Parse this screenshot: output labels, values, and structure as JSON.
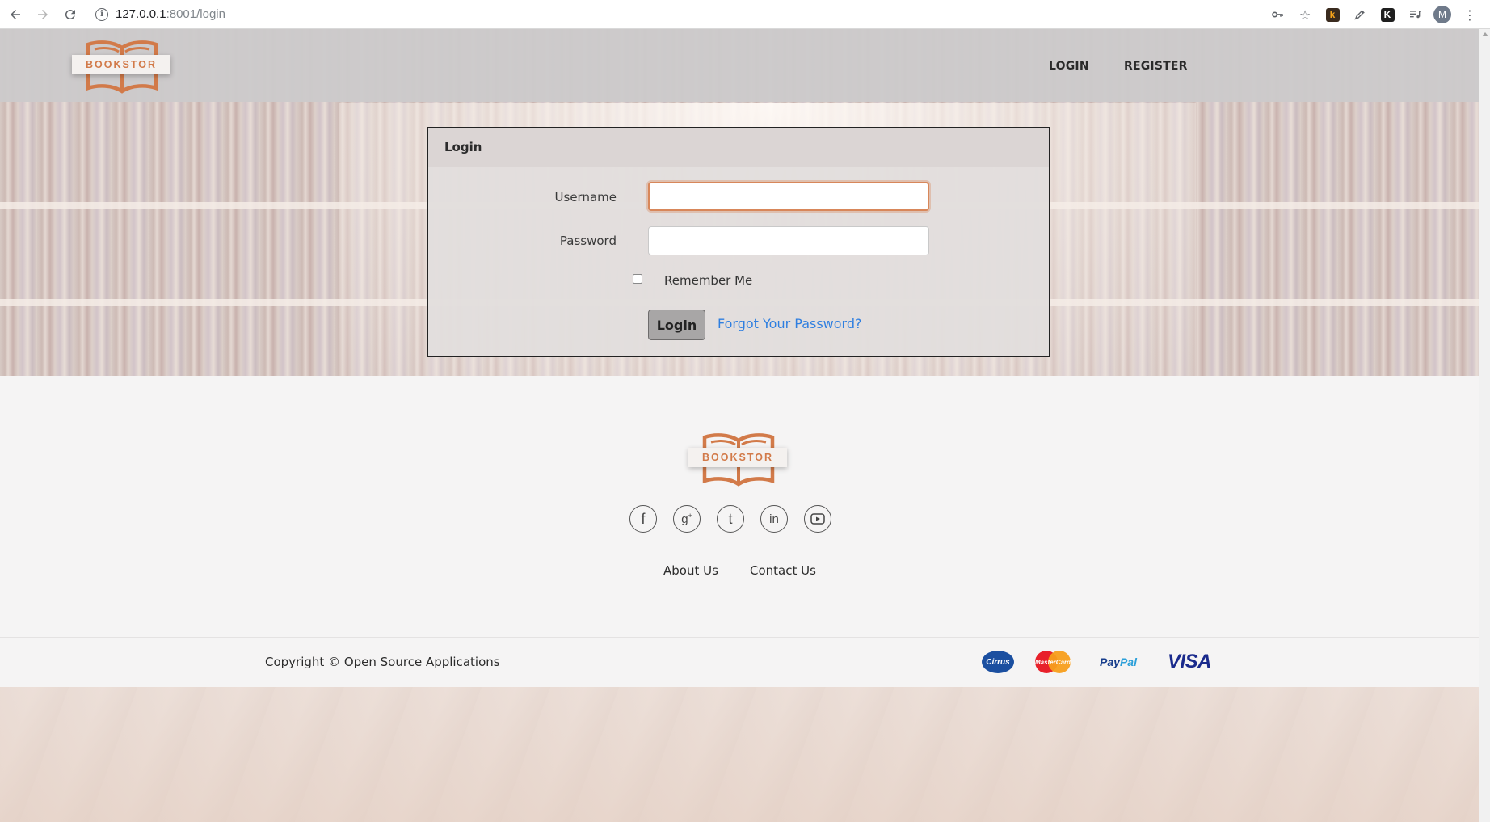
{
  "browser": {
    "url_host": "127.0.0.1",
    "url_rest": ":8001/login",
    "avatar_letter": "M",
    "extensions": [
      "k",
      "K"
    ]
  },
  "header": {
    "logo_text": "BOOKSTOR",
    "nav": [
      {
        "label": "LOGIN"
      },
      {
        "label": "REGISTER"
      }
    ]
  },
  "login_form": {
    "title": "Login",
    "username_label": "Username",
    "username_value": "",
    "password_label": "Password",
    "password_value": "",
    "remember_label": "Remember Me",
    "remember_checked": false,
    "submit_label": "Login",
    "forgot_label": "Forgot Your Password?"
  },
  "footer": {
    "logo_text": "BOOKSTOR",
    "social_icons": [
      "facebook-icon",
      "google-plus-icon",
      "tumblr-icon",
      "linkedin-icon",
      "youtube-icon"
    ],
    "links": [
      {
        "label": "About Us"
      },
      {
        "label": "Contact Us"
      }
    ],
    "copyright": "Copyright © Open Source Applications",
    "payments": {
      "cirrus": "Cirrus",
      "mastercard": "MasterCard",
      "paypal_a": "Pay",
      "paypal_b": "Pal",
      "visa": "VISA"
    }
  },
  "colors": {
    "accent": "#d27a49",
    "link": "#2f7fe0",
    "header_bg": "#cccacb",
    "footer_bg": "#f5f4f4"
  }
}
